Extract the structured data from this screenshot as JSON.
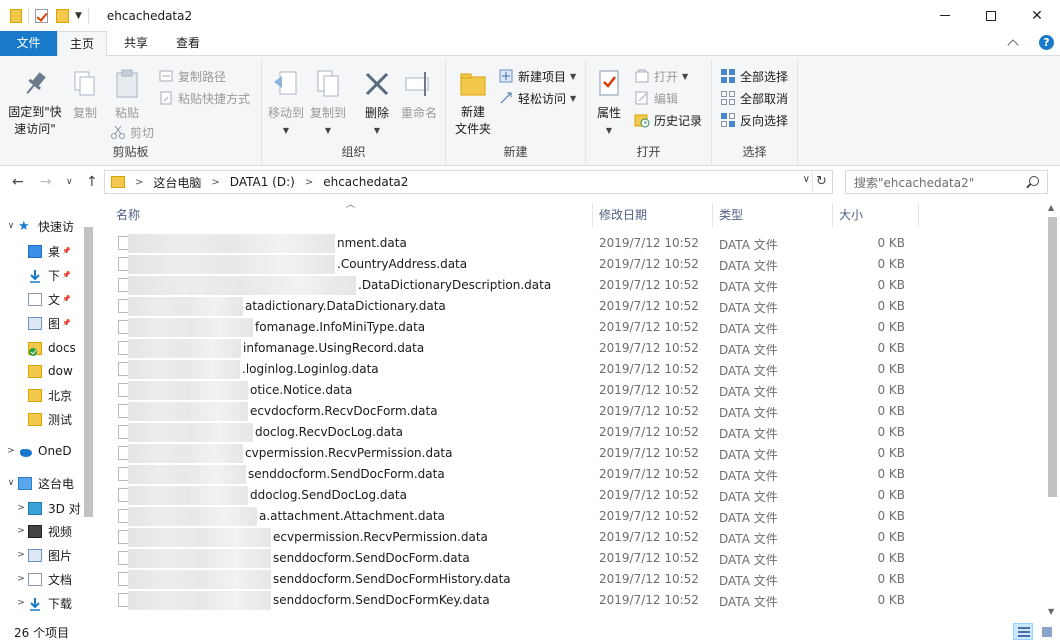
{
  "window": {
    "title": "ehcachedata2",
    "controls": {
      "minimize": "minimize",
      "maximize": "maximize",
      "close": "✕"
    }
  },
  "ribbon_tabs": [
    "文件",
    "主页",
    "共享",
    "查看"
  ],
  "ribbon": {
    "clipboard": {
      "label": "剪贴板",
      "pin": "固定到\"快\n速访问\"",
      "copy": "复制",
      "paste": "粘贴",
      "copy_path": "复制路径",
      "paste_shortcut": "粘贴快捷方式",
      "cut": "剪切"
    },
    "organize": {
      "label": "组织",
      "move_to": "移动到",
      "copy_to": "复制到",
      "delete": "删除",
      "rename": "重命名"
    },
    "new": {
      "label": "新建",
      "new_folder": "新建\n文件夹",
      "new_item": "新建项目",
      "easy_access": "轻松访问"
    },
    "open": {
      "label": "打开",
      "properties": "属性",
      "open": "打开",
      "edit": "编辑",
      "history": "历史记录"
    },
    "select": {
      "label": "选择",
      "select_all": "全部选择",
      "select_none": "全部取消",
      "invert": "反向选择"
    }
  },
  "address": {
    "crumbs": [
      "这台电脑",
      "DATA1 (D:)",
      "ehcachedata2"
    ],
    "search_placeholder": "搜索\"ehcachedata2\""
  },
  "nav_pane": {
    "items": [
      {
        "label": "快速访",
        "icon": "star-icon",
        "level": 0,
        "expand": "∨"
      },
      {
        "label": "桌",
        "icon": "desktop-icon",
        "level": 1,
        "pin": true
      },
      {
        "label": "下",
        "icon": "download-icon",
        "level": 1,
        "pin": true
      },
      {
        "label": "文",
        "icon": "document-icon",
        "level": 1,
        "pin": true
      },
      {
        "label": "图",
        "icon": "picture-icon",
        "level": 1,
        "pin": true
      },
      {
        "label": "docs",
        "icon": "sync-folder-icon",
        "level": 1
      },
      {
        "label": "dow",
        "icon": "folder-icon",
        "level": 1
      },
      {
        "label": "北京",
        "icon": "folder-icon",
        "level": 1
      },
      {
        "label": "测试",
        "icon": "folder-icon",
        "level": 1
      },
      {
        "label": "OneD",
        "icon": "cloud-icon",
        "level": 0,
        "expand": ">"
      },
      {
        "label": "这台电",
        "icon": "computer-icon",
        "level": 0,
        "expand": "∨"
      },
      {
        "label": "3D 对",
        "icon": "cube-icon",
        "level": 1,
        "expand": ">"
      },
      {
        "label": "视频",
        "icon": "video-icon",
        "level": 1,
        "expand": ">"
      },
      {
        "label": "图片",
        "icon": "picture-icon",
        "level": 1,
        "expand": ">"
      },
      {
        "label": "文档",
        "icon": "document-icon",
        "level": 1,
        "expand": ">"
      },
      {
        "label": "下载",
        "icon": "download-icon",
        "level": 1,
        "expand": ">"
      }
    ]
  },
  "columns": {
    "name": "名称",
    "date": "修改日期",
    "type": "类型",
    "size": "大小"
  },
  "files": [
    {
      "name": "nment.data",
      "date": "2019/7/12 10:52",
      "type": "DATA 文件",
      "size": "0 KB"
    },
    {
      "name": ".CountryAddress.data",
      "date": "2019/7/12 10:52",
      "type": "DATA 文件",
      "size": "0 KB"
    },
    {
      "name": ".DataDictionaryDescription.data",
      "date": "2019/7/12 10:52",
      "type": "DATA 文件",
      "size": "0 KB"
    },
    {
      "name": "atadictionary.DataDictionary.data",
      "date": "2019/7/12 10:52",
      "type": "DATA 文件",
      "size": "0 KB"
    },
    {
      "name": "fomanage.InfoMiniType.data",
      "date": "2019/7/12 10:52",
      "type": "DATA 文件",
      "size": "0 KB"
    },
    {
      "name": "infomanage.UsingRecord.data",
      "date": "2019/7/12 10:52",
      "type": "DATA 文件",
      "size": "0 KB"
    },
    {
      "name": ".loginlog.Loginlog.data",
      "date": "2019/7/12 10:52",
      "type": "DATA 文件",
      "size": "0 KB"
    },
    {
      "name": "otice.Notice.data",
      "date": "2019/7/12 10:52",
      "type": "DATA 文件",
      "size": "0 KB"
    },
    {
      "name": "ecvdocform.RecvDocForm.data",
      "date": "2019/7/12 10:52",
      "type": "DATA 文件",
      "size": "0 KB"
    },
    {
      "name": "doclog.RecvDocLog.data",
      "date": "2019/7/12 10:52",
      "type": "DATA 文件",
      "size": "0 KB"
    },
    {
      "name": "cvpermission.RecvPermission.data",
      "date": "2019/7/12 10:52",
      "type": "DATA 文件",
      "size": "0 KB"
    },
    {
      "name": "senddocform.SendDocForm.data",
      "date": "2019/7/12 10:52",
      "type": "DATA 文件",
      "size": "0 KB"
    },
    {
      "name": "ddoclog.SendDocLog.data",
      "date": "2019/7/12 10:52",
      "type": "DATA 文件",
      "size": "0 KB"
    },
    {
      "name": "a.attachment.Attachment.data",
      "date": "2019/7/12 10:52",
      "type": "DATA 文件",
      "size": "0 KB"
    },
    {
      "name": "ecvpermission.RecvPermission.data",
      "date": "2019/7/12 10:52",
      "type": "DATA 文件",
      "size": "0 KB"
    },
    {
      "name": "senddocform.SendDocForm.data",
      "date": "2019/7/12 10:52",
      "type": "DATA 文件",
      "size": "0 KB"
    },
    {
      "name": "senddocform.SendDocFormHistory.data",
      "date": "2019/7/12 10:52",
      "type": "DATA 文件",
      "size": "0 KB"
    },
    {
      "name": "senddocform.SendDocFormKey.data",
      "date": "2019/7/12 10:52",
      "type": "DATA 文件",
      "size": "0 KB"
    }
  ],
  "status": {
    "item_count": "26 个项目"
  },
  "colors": {
    "accent": "#1979ca",
    "ribbon_bg": "#f5f6f7",
    "header_text": "#4d6082"
  }
}
